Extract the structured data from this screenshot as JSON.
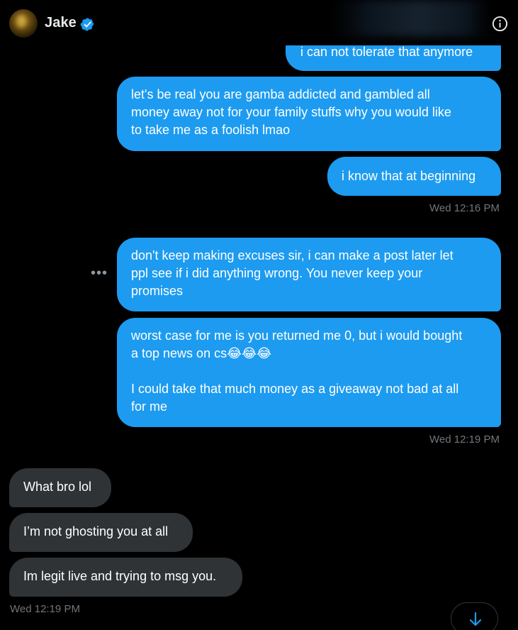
{
  "header": {
    "contact_name": "Jake",
    "avatar_icon": "avatar-image",
    "verified_icon": "verified-badge-icon",
    "info_icon": "info-icon"
  },
  "messages": [
    {
      "direction": "outgoing",
      "text": "i can not tolerate that anymore"
    },
    {
      "direction": "outgoing",
      "text": "let's be real you are gamba addicted and gambled all\nmoney away not for your family stuffs why you would like\nto take me as a foolish lmao"
    },
    {
      "direction": "outgoing",
      "text": "i know that at beginning"
    },
    {
      "direction": "timestamp",
      "text": "Wed 12:16 PM"
    },
    {
      "direction": "outgoing",
      "text": "don't keep making excuses sir, i can make a post later let\nppl see if i did anything wrong. You never keep your\npromises"
    },
    {
      "direction": "outgoing",
      "text": "worst case for me is you returned me 0, but i would bought\na top news on cs😂😂😂\n\nI could take that much money as a giveaway not bad at all\nfor me"
    },
    {
      "direction": "timestamp",
      "text": "Wed 12:19 PM"
    },
    {
      "direction": "incoming",
      "text": "What bro lol"
    },
    {
      "direction": "incoming",
      "text": "I’m not ghosting you at all"
    },
    {
      "direction": "incoming",
      "text": "Im legit live and trying to msg you."
    },
    {
      "direction": "timestamp",
      "text": "Wed 12:19 PM"
    }
  ],
  "more_options_label": "•••",
  "scroll_down_icon": "arrow-down-icon",
  "colors": {
    "outgoing_bubble": "#1d9bf0",
    "incoming_bubble": "#2f3336",
    "timestamp": "#71767b",
    "background": "#000000"
  }
}
